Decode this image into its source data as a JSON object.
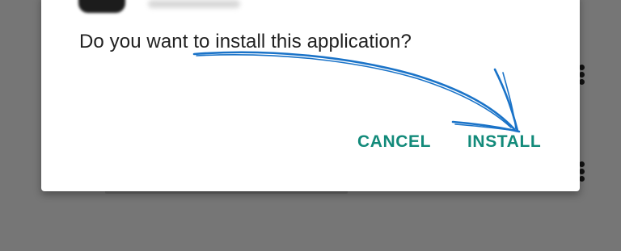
{
  "dialog": {
    "question": "Do you want to install this application?",
    "buttons": {
      "cancel": "CANCEL",
      "install": "INSTALL"
    }
  },
  "annotation": {
    "icon": "hand-drawn-arrow-icon",
    "color": "#1a73c8"
  },
  "colors": {
    "button_text": "#128a7a",
    "backdrop": "#767676",
    "dialog_bg": "#ffffff"
  }
}
